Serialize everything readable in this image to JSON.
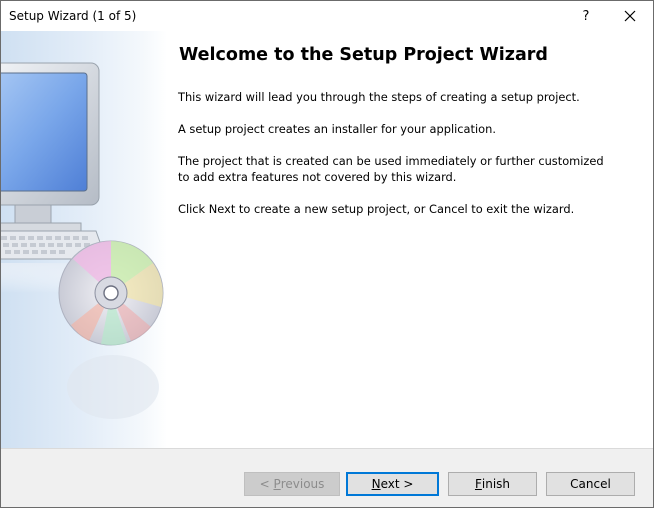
{
  "window": {
    "title": "Setup Wizard (1 of 5)",
    "help_label": "?"
  },
  "page": {
    "heading": "Welcome to the Setup Project Wizard",
    "paragraphs": [
      "This wizard will lead you through the steps of creating a setup project.",
      "A setup project creates an installer for your application.",
      "The project that is created can be used immediately or further customized to add extra features not covered by this wizard.",
      "Click Next to create a new setup project, or Cancel to exit the wizard."
    ]
  },
  "buttons": {
    "previous": {
      "mnemonic": "P",
      "rest": "revious",
      "prefix": "< ",
      "enabled": false
    },
    "next": {
      "mnemonic": "N",
      "rest": "ext >",
      "enabled": true,
      "default": true
    },
    "finish": {
      "mnemonic": "F",
      "rest": "inish",
      "enabled": true
    },
    "cancel": {
      "label": "Cancel",
      "enabled": true
    }
  },
  "colors": {
    "focus_border": "#0078d7",
    "footer_bg": "#f0f0f0",
    "disabled_text": "#8c8c8c"
  },
  "icons": [
    "help-icon",
    "close-icon",
    "computer-illustration",
    "cd-disc-illustration"
  ]
}
